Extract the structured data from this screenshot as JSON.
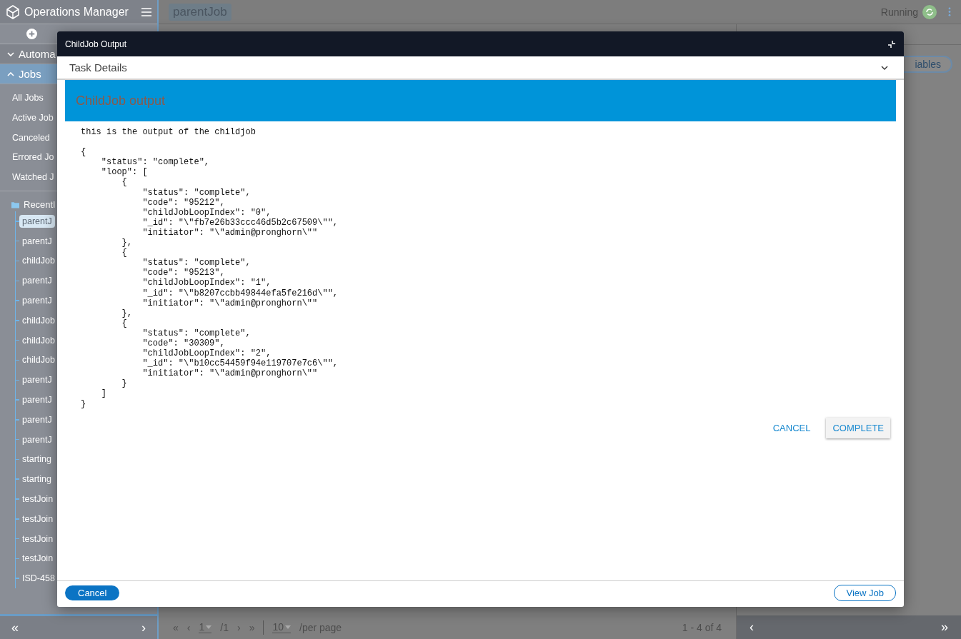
{
  "app": {
    "title": "Operations Manager"
  },
  "sidebar": {
    "groups": [
      {
        "label": "Automa",
        "expanded": false,
        "selected": false
      },
      {
        "label": "Jobs",
        "expanded": true,
        "selected": true
      }
    ],
    "items": [
      "All Jobs",
      "Active Job",
      "Canceled",
      "Errored Jo",
      "Watched J"
    ],
    "recent": {
      "label": "Recentl",
      "items": [
        {
          "label": "parentJ",
          "selected": true
        },
        {
          "label": "parentJ",
          "selected": false
        },
        {
          "label": "childJob",
          "selected": false
        },
        {
          "label": "parentJ",
          "selected": false
        },
        {
          "label": "parentJ",
          "selected": false
        },
        {
          "label": "childJob",
          "selected": false
        },
        {
          "label": "childJob",
          "selected": false
        },
        {
          "label": "childJob",
          "selected": false
        },
        {
          "label": "parentJ",
          "selected": false
        },
        {
          "label": "parentJ",
          "selected": false
        },
        {
          "label": "parentJ",
          "selected": false
        },
        {
          "label": "parentJ",
          "selected": false
        },
        {
          "label": "starting",
          "selected": false
        },
        {
          "label": "starting",
          "selected": false
        },
        {
          "label": "testJoin",
          "selected": false
        },
        {
          "label": "testJoin",
          "selected": false
        },
        {
          "label": "testJoin",
          "selected": false
        },
        {
          "label": "testJoin",
          "selected": false
        },
        {
          "label": "ISD-458",
          "selected": false
        }
      ]
    },
    "footer": {
      "collapse": "«",
      "next": "›"
    }
  },
  "header": {
    "job": "parentJob",
    "status": "Running"
  },
  "right_panel": {
    "button": "iables",
    "footer": {
      "prev": "‹",
      "expand": "»"
    }
  },
  "pagination": {
    "first": "«",
    "prev": "‹",
    "page": "1",
    "pages": "/1",
    "next": "›",
    "last": "»",
    "per_page": "10",
    "per_page_label": "/per page",
    "range": "1 - 4 of 4"
  },
  "modal": {
    "title": "ChildJob Output",
    "section": "Task Details",
    "banner": "ChildJob output",
    "output": "this is the output of the childjob\n\n{\n    \"status\": \"complete\",\n    \"loop\": [\n        {\n            \"status\": \"complete\",\n            \"code\": \"95212\",\n            \"childJobLoopIndex\": \"0\",\n            \"_id\": \"\\\"fb7e26b33ccc46d5b2c67509\\\"\",\n            \"initiator\": \"\\\"admin@pronghorn\\\"\"\n        },\n        {\n            \"status\": \"complete\",\n            \"code\": \"95213\",\n            \"childJobLoopIndex\": \"1\",\n            \"_id\": \"\\\"b8207ccbb49844efa5fe216d\\\"\",\n            \"initiator\": \"\\\"admin@pronghorn\\\"\"\n        },\n        {\n            \"status\": \"complete\",\n            \"code\": \"30309\",\n            \"childJobLoopIndex\": \"2\",\n            \"_id\": \"\\\"b10cc54459f94e119707e7c6\\\"\",\n            \"initiator\": \"\\\"admin@pronghorn\\\"\"\n        }\n    ]\n}",
    "actions": {
      "cancel": "CANCEL",
      "complete": "COMPLETE"
    },
    "footer": {
      "cancel": "Cancel",
      "view": "View Job"
    }
  }
}
